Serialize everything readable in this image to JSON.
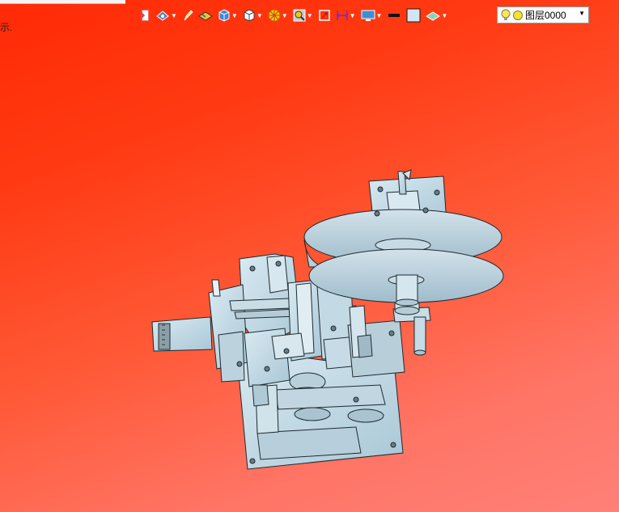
{
  "side_text": "示.",
  "layer": {
    "name": "图层0000"
  },
  "toolbar": {
    "items": [
      "exit-icon",
      "view-orientation-icon",
      "pencil-icon",
      "render-material-icon",
      "shaded-cube-icon",
      "wire-cube-icon",
      "section-wheel-icon",
      "zoom-icon",
      "fit-icon",
      "dimension-icon",
      "display-icon",
      "line-color-swatch",
      "fill-color-swatch",
      "layer-style-icon"
    ]
  },
  "colors": {
    "background_top": "#ff2a05",
    "background_bottom": "#ff8078",
    "model": "#c6dbe6",
    "model_edge": "#1e2a30"
  }
}
